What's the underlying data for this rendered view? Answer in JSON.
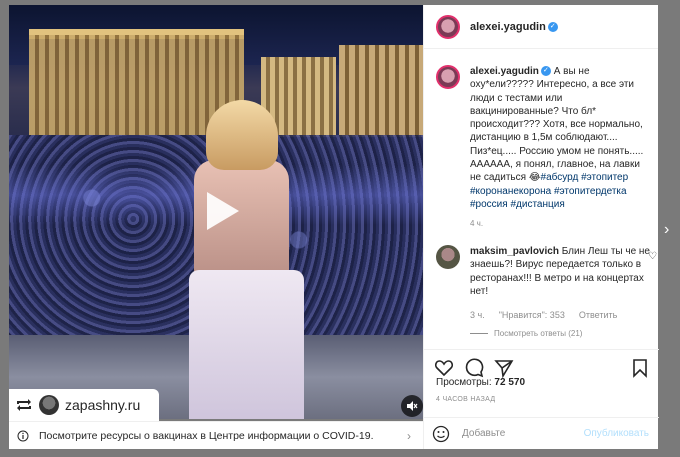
{
  "video": {
    "repost_name": "zapashny.ru"
  },
  "covid_banner": {
    "text": "Посмотрите ресурсы о вакцинах в Центре информации о COVID-19."
  },
  "header": {
    "username": "alexei.yagudin"
  },
  "caption": {
    "username": "alexei.yagudin",
    "text_before": " А вы не оху*ели????? Интересно, а все эти люди с тестами или вакцинированные? Что бл* происходит??? Хотя, все нормально, дистанцию в 1,5м соблюдают.... Пиз*ец..... Россию умом не понять..... АААААА, я понял, главное, на лавки не садиться 😂",
    "hashtags": [
      "#абсурд",
      "#этопитер",
      "#коронанекорона",
      "#этопитердетка",
      "#россия",
      "#дистанция"
    ],
    "time": "4 ч."
  },
  "comment": {
    "username": "maksim_pavlovich",
    "text": " Блин Леш ты че не знаешь?! Вирус передается только в ресторанах!!! В метро и на концертах нет!",
    "time": "3 ч.",
    "likes": "\"Нравится\": 353",
    "reply": "Ответить",
    "view_replies": "Посмотреть ответы (21)"
  },
  "stats": {
    "views_label": "Просмотры:",
    "views_value": "72 570",
    "post_time": "4 ЧАСОВ НАЗАД"
  },
  "add_comment": {
    "placeholder": "Добавьте",
    "publish": "Опубликовать"
  },
  "icons": {
    "like": "heart-icon",
    "comment": "comment-icon",
    "share": "share-icon",
    "save": "bookmark-icon",
    "emoji": "emoji-icon",
    "play": "play-icon",
    "mute": "mute-icon",
    "next": "chevron-right-icon"
  },
  "colors": {
    "accent": "#3897f0",
    "hashtag": "#00376b",
    "muted_text": "#8e8e8e",
    "publish_disabled": "#b2dffc"
  }
}
